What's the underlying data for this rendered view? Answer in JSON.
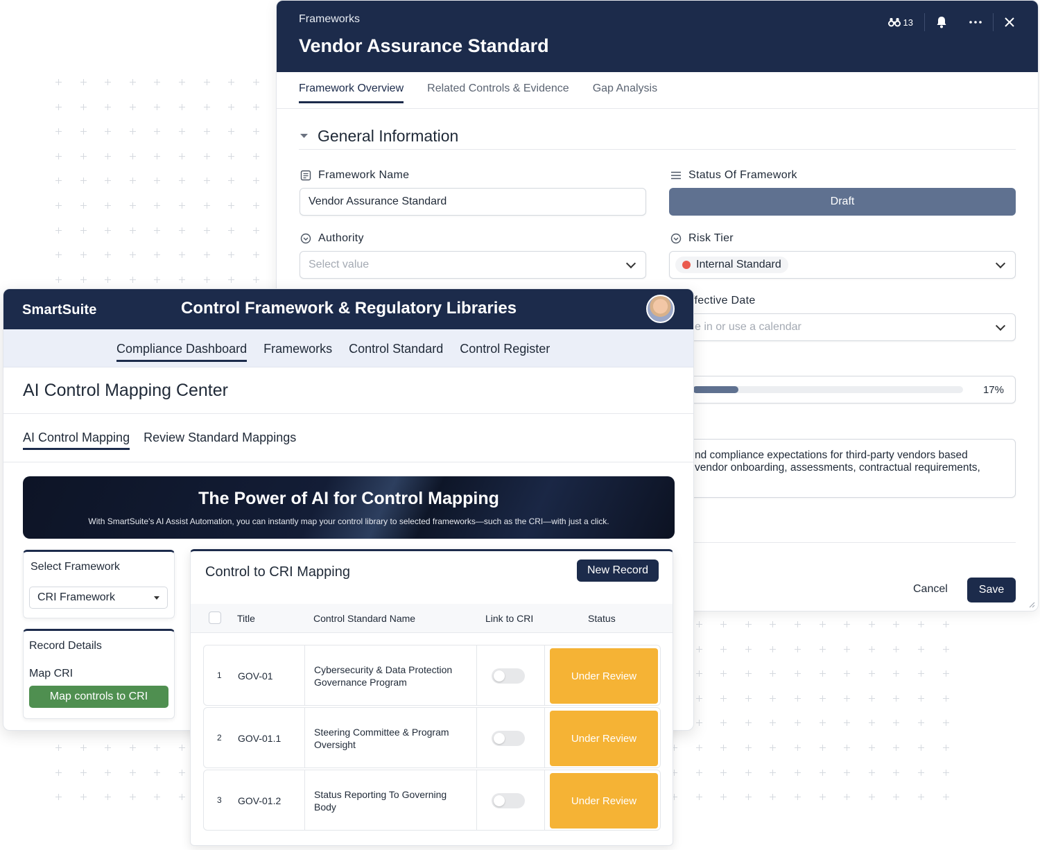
{
  "framework_panel": {
    "kicker": "Frameworks",
    "title": "Vendor Assurance Standard",
    "header_actions": {
      "binoculars_count": "13"
    },
    "tabs": [
      {
        "label": "Framework Overview",
        "active": true
      },
      {
        "label": "Related Controls & Evidence",
        "active": false
      },
      {
        "label": "Gap Analysis",
        "active": false
      }
    ],
    "section_title": "General Information",
    "fields": {
      "framework_name": {
        "label": "Framework Name",
        "value": "Vendor Assurance Standard"
      },
      "status": {
        "label": "Status Of Framework",
        "value": "Draft"
      },
      "authority": {
        "label": "Authority",
        "placeholder": "Select value"
      },
      "risk_tier": {
        "label": "Risk Tier",
        "value": "Internal Standard",
        "dot_color": "#ea5b4f"
      },
      "effective_date": {
        "label": "ffective Date",
        "placeholder": "e in or use a calendar"
      },
      "progress": {
        "value_text": "17%",
        "value": 17
      },
      "description": {
        "line1": "nd compliance expectations for third-party vendors based",
        "line2": "vendor onboarding, assessments, contractual requirements,"
      }
    },
    "footer": {
      "cancel": "Cancel",
      "save": "Save"
    }
  },
  "smartsuite_panel": {
    "logo": "SmartSuite",
    "title": "Control Framework & Regulatory Libraries",
    "nav": [
      {
        "label": "Compliance Dashboard",
        "active": true
      },
      {
        "label": "Frameworks",
        "active": false
      },
      {
        "label": "Control Standard",
        "active": false
      },
      {
        "label": "Control Register",
        "active": false
      }
    ],
    "page_title": "AI Control Mapping Center",
    "subtabs": [
      {
        "label": "AI Control Mapping",
        "active": true
      },
      {
        "label": "Review Standard Mappings",
        "active": false
      }
    ],
    "hero": {
      "title": "The Power of AI for Control Mapping",
      "subtitle": "With SmartSuite's AI Assist Automation, you can instantly map your control library to selected frameworks—such as the CRI—with just a click."
    },
    "select_framework": {
      "title": "Select Framework",
      "value": "CRI Framework"
    },
    "record_details": {
      "title": "Record Details",
      "map_label": "Map CRI",
      "button": "Map controls to CRI"
    }
  },
  "mapping_table": {
    "title": "Control to CRI Mapping",
    "new_record": "New Record",
    "columns": {
      "title": "Title",
      "name": "Control Standard Name",
      "link": "Link to CRI",
      "status": "Status"
    },
    "rows": [
      {
        "num": "1",
        "title": "GOV-01",
        "name": "Cybersecurity & Data Protection Governance Program",
        "status": "Under Review",
        "linked": false
      },
      {
        "num": "2",
        "title": "GOV-01.1",
        "name": "Steering Committee & Program Oversight",
        "status": "Under Review",
        "linked": false
      },
      {
        "num": "3",
        "title": "GOV-01.2",
        "name": "Status Reporting To Governing Body",
        "status": "Under Review",
        "linked": false
      }
    ],
    "status_color": "#f5b335"
  },
  "colors": {
    "navy": "#1c2b4b",
    "draft": "#5f7190",
    "green": "#4f8f50"
  }
}
